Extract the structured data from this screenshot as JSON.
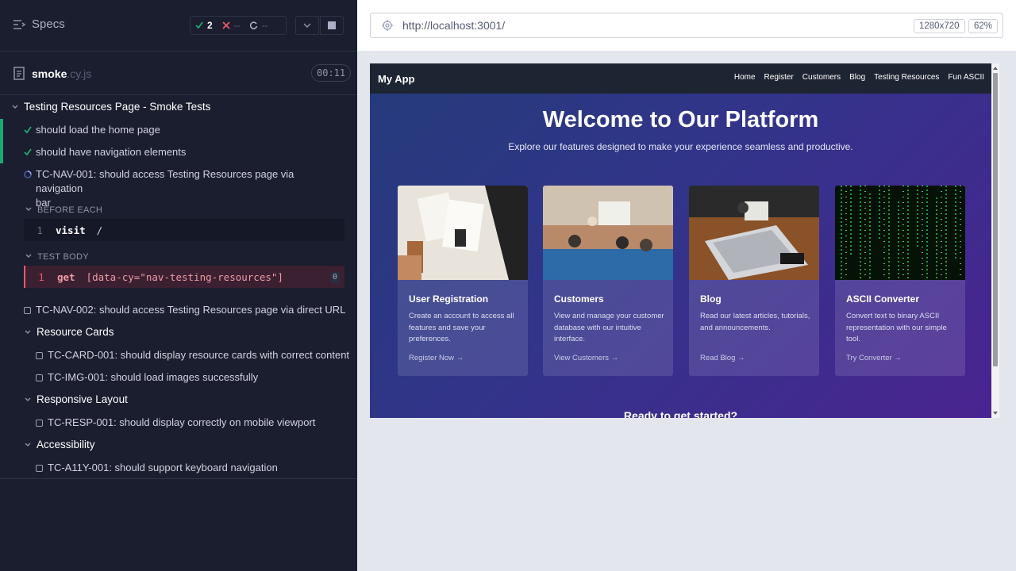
{
  "reporter": {
    "specs_label": "Specs",
    "stats": {
      "passed": "2",
      "failed": "--",
      "pending": "--"
    },
    "spec": {
      "name": "smoke",
      "ext": ".cy.js",
      "duration": "00:11"
    },
    "suite": "Testing Resources Page - Smoke Tests",
    "tests": [
      {
        "title": "should load the home page",
        "state": "passed"
      },
      {
        "title": "should have navigation elements",
        "state": "passed"
      },
      {
        "title_line1": "TC-NAV-001: should access Testing Resources page via navigation",
        "title_line2": "bar",
        "state": "running"
      }
    ],
    "hooks": {
      "before_each": {
        "label": "BEFORE EACH",
        "line": "1",
        "command": "visit",
        "arg": "/"
      },
      "test_body": {
        "label": "TEST BODY",
        "line": "1",
        "command": "get",
        "arg": "[data-cy=\"nav-testing-resources\"]",
        "badge": "0"
      }
    },
    "test_nav002": "TC-NAV-002: should access Testing Resources page via direct URL",
    "groups": [
      {
        "name": "Resource Cards",
        "tests": [
          "TC-CARD-001: should display resource cards with correct content",
          "TC-IMG-001: should load images successfully"
        ]
      },
      {
        "name": "Responsive Layout",
        "tests": [
          "TC-RESP-001: should display correctly on mobile viewport"
        ]
      },
      {
        "name": "Accessibility",
        "tests": [
          "TC-A11Y-001: should support keyboard navigation"
        ]
      }
    ]
  },
  "preview": {
    "url": "http://localhost:3001/",
    "viewport_size": "1280x720",
    "zoom": "62%",
    "app": {
      "brand": "My App",
      "nav": [
        "Home",
        "Register",
        "Customers",
        "Blog",
        "Testing Resources",
        "Fun ASCII"
      ],
      "hero_title": "Welcome to Our Platform",
      "hero_subtitle": "Explore our features designed to make your experience seamless and productive.",
      "cards": [
        {
          "title": "User Registration",
          "desc": "Create an account to access all features and save your preferences.",
          "link": "Register Now"
        },
        {
          "title": "Customers",
          "desc": "View and manage your customer database with our intuitive interface.",
          "link": "View Customers"
        },
        {
          "title": "Blog",
          "desc": "Read our latest articles, tutorials, and announcements.",
          "link": "Read Blog"
        },
        {
          "title": "ASCII Converter",
          "desc": "Convert text to binary ASCII representation with our simple tool.",
          "link": "Try Converter"
        }
      ],
      "cta": "Ready to get started?"
    }
  },
  "colors": {
    "pass": "#1fa971",
    "fail": "#e85a6a",
    "reporter_bg": "#1b1e2e",
    "nav_bg": "#1e2532"
  }
}
